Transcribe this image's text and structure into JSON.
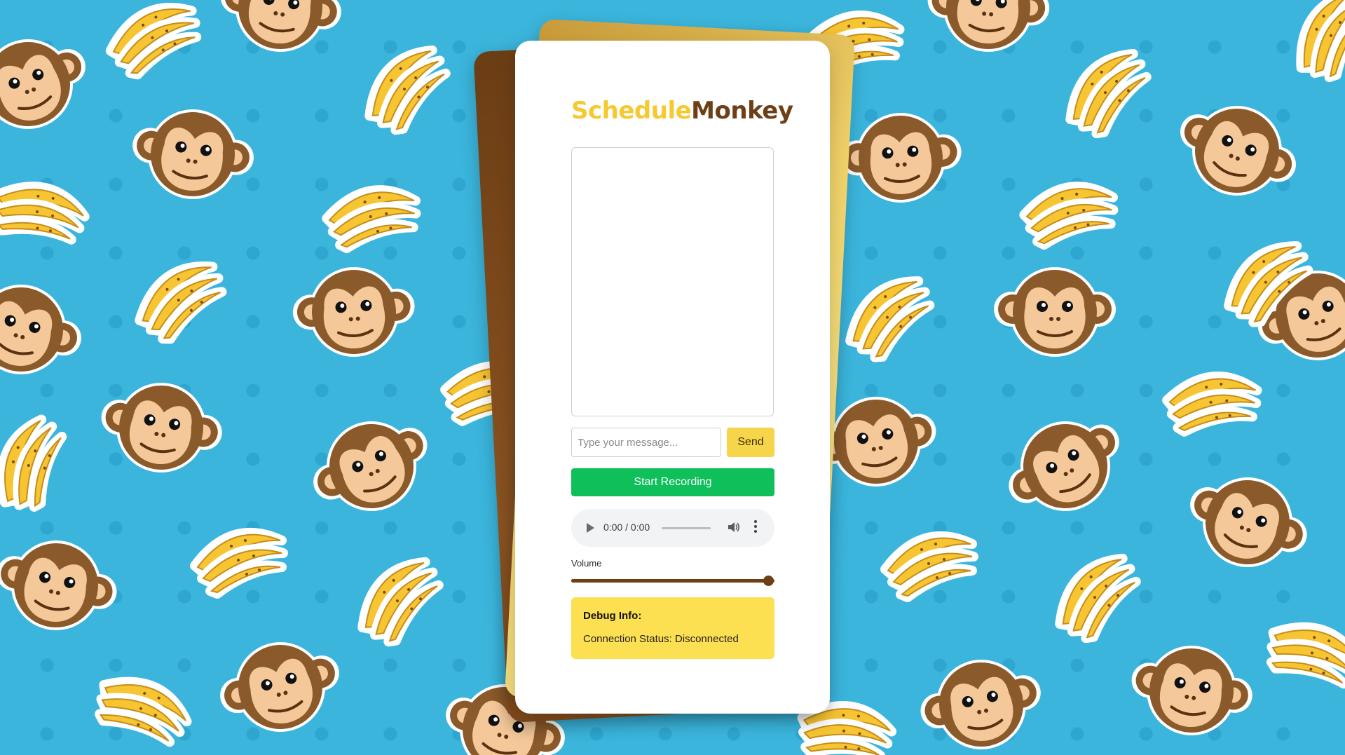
{
  "app": {
    "title_part1": "Schedule",
    "title_part2": "Monkey"
  },
  "chat": {
    "messages": []
  },
  "message_input": {
    "placeholder": "Type your message...",
    "value": ""
  },
  "buttons": {
    "send_label": "Send",
    "record_label": "Start Recording"
  },
  "audio_player": {
    "time": "0:00 / 0:00",
    "icons": [
      "play-icon",
      "volume-icon",
      "more-vertical-icon"
    ]
  },
  "volume": {
    "label": "Volume",
    "level": 1.0
  },
  "debug": {
    "title": "Debug Info:",
    "connection_status": "Connection Status: Disconnected"
  },
  "colors": {
    "background": "#3bb5dc",
    "title_accent": "#f5c932",
    "title_brand": "#6e3f16",
    "send_button": "#f7d54a",
    "record_button": "#0fbf5a",
    "debug_panel": "#fddf52",
    "slider": "#6e3f16",
    "monkey_fur": "#8b5a2b",
    "monkey_face": "#f5c89a",
    "banana": "#f7c531"
  },
  "background_pattern": {
    "icons": [
      "monkey-face-icon",
      "banana-bunch-icon"
    ]
  }
}
